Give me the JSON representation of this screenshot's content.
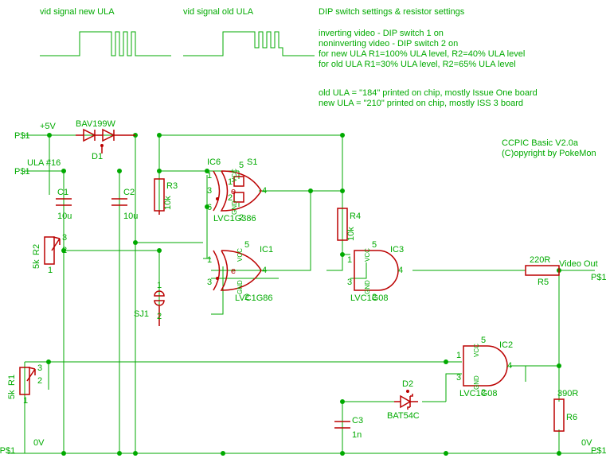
{
  "title": "CCPIC Basic V2.0a",
  "copyright": "(C)opyright by PokeMon",
  "waveform_labels": {
    "new": "vid signal new ULA",
    "old": "vid signal old ULA"
  },
  "notes_title": "DIP switch settings & resistor settings",
  "notes": [
    "inverting video - DIP switch 1 on",
    "noninverting video - DIP switch 2 on",
    "for new ULA R1=100% ULA level, R2=40% ULA level",
    "for old ULA R1=30% ULA level, R2=65% ULA level",
    "",
    "old ULA = \"184\" printed on chip, mostly Issue One board",
    "new ULA = \"210\" printed on chip, mostly ISS 3 board"
  ],
  "nets": {
    "p5v": "+5V",
    "ula": "ULA #16",
    "gnd": "0V",
    "out": "Video Out",
    "pad": "P$1"
  },
  "components": {
    "D1": {
      "ref": "D1",
      "val": "BAV199W"
    },
    "C1": {
      "ref": "C1",
      "val": "10u"
    },
    "C2": {
      "ref": "C2",
      "val": "10u"
    },
    "C3": {
      "ref": "C3",
      "val": "1n"
    },
    "R1": {
      "ref": "R1",
      "val": "5k"
    },
    "R2": {
      "ref": "R2",
      "val": "5k"
    },
    "R3": {
      "ref": "R3",
      "val": "10k"
    },
    "R4": {
      "ref": "R4",
      "val": "10k"
    },
    "R5": {
      "ref": "R5",
      "val": "220R"
    },
    "R6": {
      "ref": "R6",
      "val": "390R"
    },
    "IC1": {
      "ref": "IC1",
      "val": "LVC1G86"
    },
    "IC2": {
      "ref": "IC2",
      "val": "LVC1G08"
    },
    "IC3": {
      "ref": "IC3",
      "val": "LVC1G08"
    },
    "IC6": {
      "ref": "IC6",
      "val": "LVC1G386"
    },
    "D2": {
      "ref": "D2",
      "val": "BAT54C"
    },
    "S1": {
      "ref": "S1",
      "val": ""
    },
    "SJ1": {
      "ref": "SJ1",
      "val": ""
    }
  },
  "ic_pins": {
    "vcc": "VCC",
    "gnd": "GND",
    "e": "e"
  },
  "pins": {
    "1": "1",
    "2": "2",
    "3": "3",
    "4": "4",
    "5": "5",
    "6": "6",
    "8": "8"
  }
}
